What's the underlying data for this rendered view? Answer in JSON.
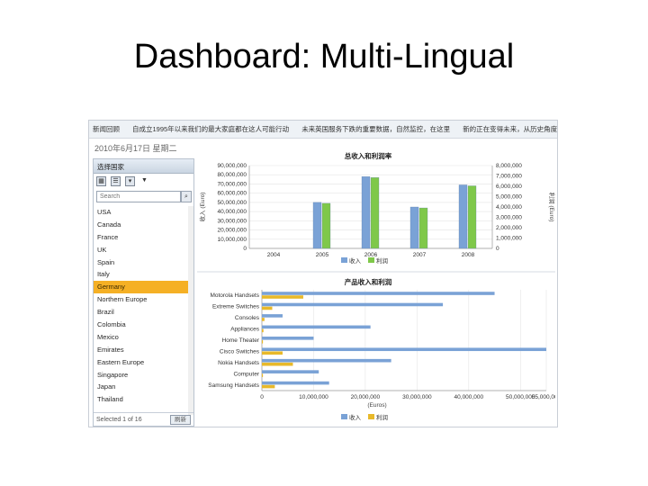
{
  "slide": {
    "title": "Dashboard:  Multi-Lingual"
  },
  "ticker": {
    "items": [
      "新闻回顾",
      "自成立1995年以来我们的最大家庭都在这人可能行动",
      "未来英国服务下跌的重要数据，自然监控，在这里",
      "新的正在变得未来，从历史角度"
    ]
  },
  "dashboard": {
    "date": "2010年6月17日 星期二",
    "panel_title": "选择国家",
    "search_placeholder": "Search",
    "tool_icons": [
      "grid-icon",
      "list-icon",
      "filter-icon",
      "chevron-down-icon"
    ],
    "countries": [
      "USA",
      "Canada",
      "France",
      "UK",
      "Spain",
      "Italy",
      "Germany",
      "Northern Europe",
      "Brazil",
      "Colombia",
      "Mexico",
      "Emirates",
      "Eastern Europe",
      "Singapore",
      "Japan",
      "Thailand"
    ],
    "selected_country": "Germany",
    "footer_text": "Selected 1 of 16",
    "footer_button": "刷新"
  },
  "chart_data": [
    {
      "type": "bar",
      "title": "总收入和利润率",
      "categories": [
        "2004",
        "2005",
        "2006",
        "2007",
        "2008"
      ],
      "ylabel": "收入 (Euro)",
      "y2label": "利润 (Euro)",
      "yticks": [
        "0",
        "10,000,000",
        "20,000,000",
        "30,000,000",
        "40,000,000",
        "50,000,000",
        "60,000,000",
        "70,000,000",
        "80,000,000",
        "90,000,000"
      ],
      "y2ticks": [
        "0",
        "1,000,000",
        "2,000,000",
        "3,000,000",
        "4,000,000",
        "5,000,000",
        "6,000,000",
        "7,000,000",
        "8,000,000"
      ],
      "ylim": [
        0,
        90000000
      ],
      "series": [
        {
          "name": "收入",
          "values": [
            0,
            50000000,
            78000000,
            45000000,
            69000000
          ],
          "color": "#7aa2d6"
        },
        {
          "name": "利润",
          "values": [
            0,
            49000000,
            77000000,
            44000000,
            68000000
          ],
          "color": "#7fc84a"
        }
      ],
      "legend": "bottom"
    },
    {
      "type": "bar",
      "orientation": "horizontal",
      "title": "产品收入和利润",
      "categories": [
        "Motorola Handsets",
        "Extreme Switches",
        "Consoles",
        "Appliances",
        "Home Theater",
        "Cisco Switches",
        "Nokia Handsets",
        "Computer",
        "Samsung Handsets"
      ],
      "xlabel": "(Euros)",
      "xticks": [
        "0",
        "10,000,000",
        "20,000,000",
        "30,000,000",
        "40,000,000",
        "50,000,000",
        "55,000,000"
      ],
      "xlim": [
        0,
        55000000
      ],
      "series": [
        {
          "name": "收入",
          "values": [
            45000000,
            35000000,
            4000000,
            21000000,
            10000000,
            57000000,
            25000000,
            11000000,
            13000000
          ],
          "color": "#7aa2d6"
        },
        {
          "name": "利润",
          "values": [
            8000000,
            2000000,
            500000,
            300000,
            200000,
            4000000,
            6000000,
            200000,
            2500000
          ],
          "color": "#e8b92a"
        }
      ],
      "legend": "bottom"
    }
  ]
}
